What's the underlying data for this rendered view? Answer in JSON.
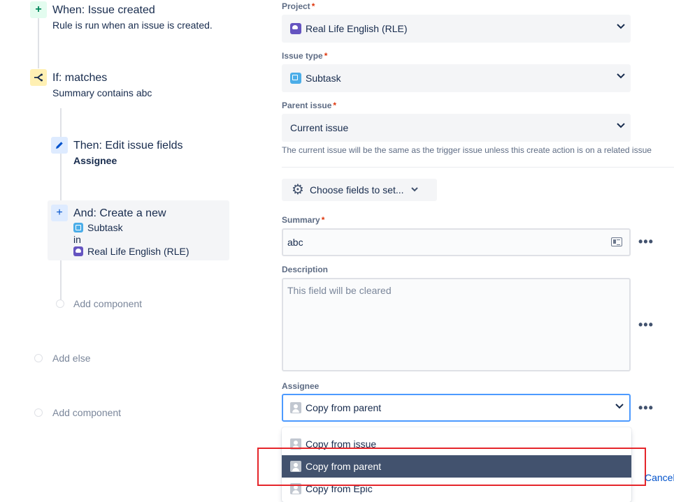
{
  "rule": {
    "trigger": {
      "icon": "plus-icon",
      "title": "When: Issue created",
      "subtitle": "Rule is run when an issue is created."
    },
    "condition": {
      "icon": "branch-icon",
      "title": "If: matches",
      "subtitle": "Summary contains abc"
    },
    "action_edit": {
      "icon": "pencil-icon",
      "title": "Then: Edit issue fields",
      "subtitle": "Assignee"
    },
    "action_create": {
      "icon": "plus-icon",
      "title": "And: Create a new",
      "issue_type": "Subtask",
      "in_label": "in",
      "project": "Real Life English (RLE)"
    },
    "add_component_inner": "Add component",
    "add_else": "Add else",
    "add_component_outer": "Add component"
  },
  "form": {
    "project": {
      "label": "Project",
      "required": "*",
      "value": "Real Life English (RLE)"
    },
    "issue_type": {
      "label": "Issue type",
      "required": "*",
      "value": "Subtask"
    },
    "parent_issue": {
      "label": "Parent issue",
      "required": "*",
      "value": "Current issue",
      "help": "The current issue will be the same as the trigger issue unless this create action is on a related issue"
    },
    "choose_fields": "Choose fields to set...",
    "summary": {
      "label": "Summary",
      "required": "*",
      "value": "abc"
    },
    "description": {
      "label": "Description",
      "placeholder": "This field will be cleared"
    },
    "assignee": {
      "label": "Assignee",
      "value": "Copy from parent",
      "options": [
        "Copy from issue",
        "Copy from parent",
        "Copy from Epic"
      ]
    },
    "more": "•••",
    "cancel": "Cancel"
  },
  "colors": {
    "highlight": "#e5252a",
    "active_option": "#42526e",
    "focus": "#4c9aff"
  }
}
